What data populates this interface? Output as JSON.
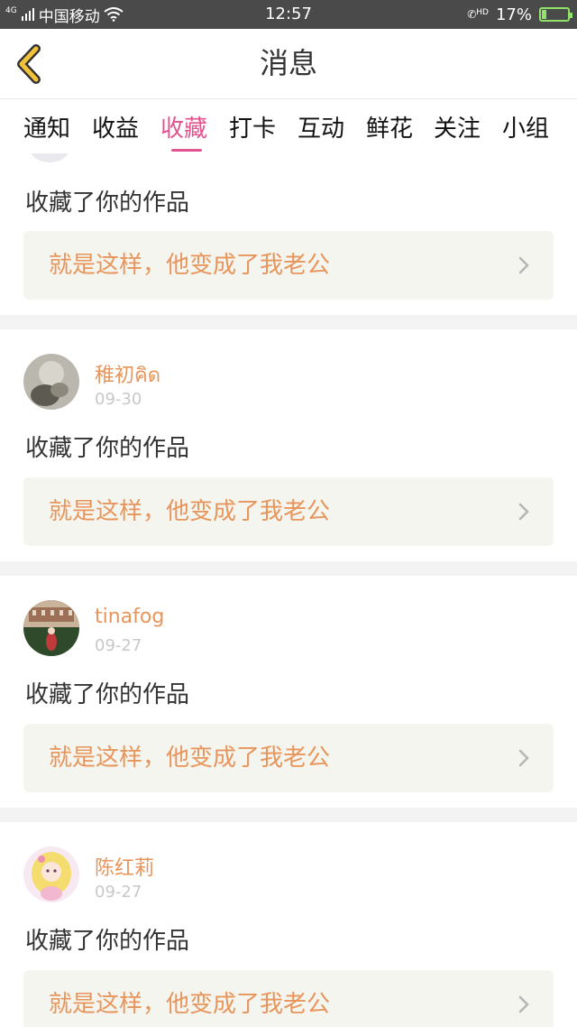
{
  "status_bar": {
    "network": "4G",
    "carrier": "中国移动",
    "time": "12:57",
    "hd_label": "HD",
    "battery": "17%",
    "battery_level": 0.17
  },
  "nav": {
    "title": "消息"
  },
  "tabs": [
    {
      "label": "通知"
    },
    {
      "label": "收益"
    },
    {
      "label": "收藏",
      "active": true
    },
    {
      "label": "打卡"
    },
    {
      "label": "互动"
    },
    {
      "label": "鲜花"
    },
    {
      "label": "关注"
    },
    {
      "label": "小组"
    }
  ],
  "colors": {
    "accent": "#e3538f",
    "username": "#e7955b",
    "card_bg": "#f5f5ef"
  },
  "feed": {
    "partial_item": {
      "action": "收藏了你的作品",
      "work_title": "就是这样，他变成了我老公"
    },
    "items": [
      {
        "user": "稚初คิด",
        "date": "09-30",
        "action": "收藏了你的作品",
        "work_title": "就是这样，他变成了我老公"
      },
      {
        "user": "tinafog",
        "date": "09-27",
        "action": "收藏了你的作品",
        "work_title": "就是这样，他变成了我老公"
      },
      {
        "user": "陈红莉",
        "date": "09-27",
        "action": "收藏了你的作品",
        "work_title": "就是这样，他变成了我老公"
      }
    ]
  }
}
